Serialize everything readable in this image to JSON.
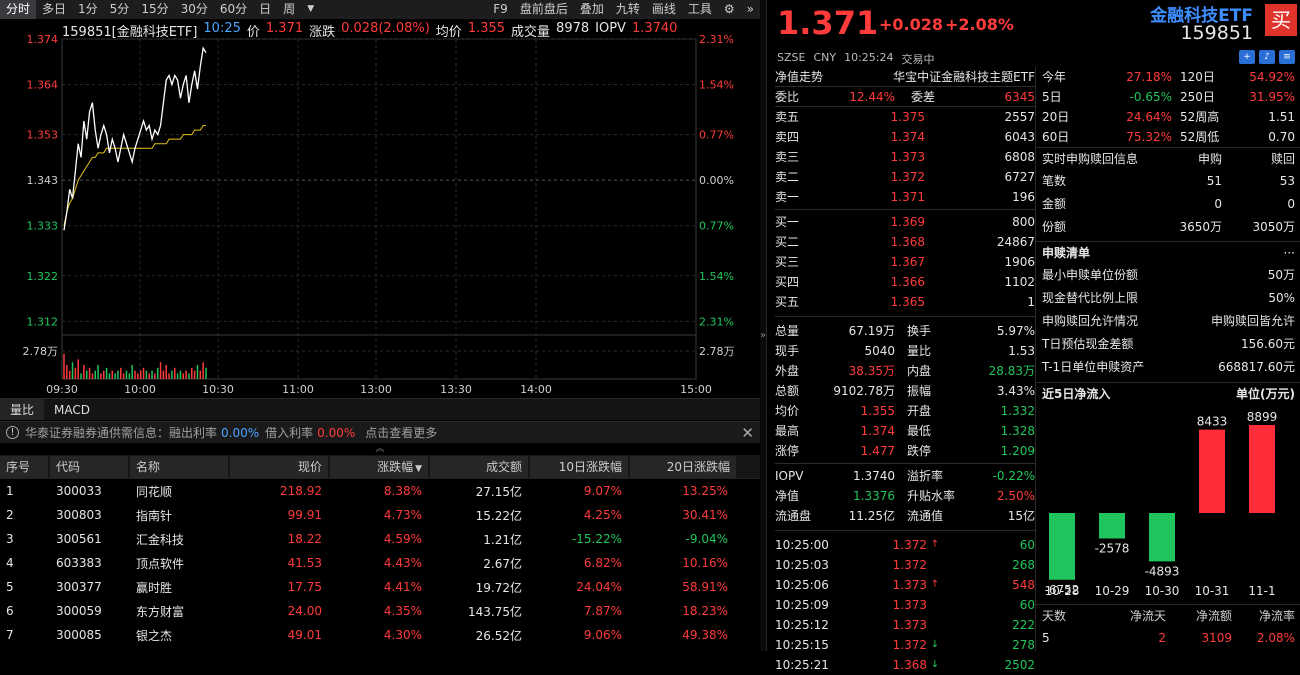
{
  "toolbar": {
    "items": [
      "分时",
      "多日",
      "1分",
      "5分",
      "15分",
      "30分",
      "60分",
      "日",
      "周"
    ],
    "tools": [
      "F9",
      "盘前盘后",
      "叠加",
      "九转",
      "画线",
      "工具"
    ]
  },
  "chart": {
    "header": {
      "code_name": "159851[金融科技ETF]",
      "time": "10:25",
      "price_label": "价",
      "price": "1.371",
      "chg_label": "涨跌",
      "chg": "0.028(2.08%)",
      "avg_label": "均价",
      "avg": "1.355",
      "vol_label": "成交量",
      "vol": "8978",
      "iopv_label": "IOPV",
      "iopv": "1.3740"
    },
    "y_left": [
      "1.374",
      "1.364",
      "1.353",
      "1.343",
      "1.333",
      "1.322",
      "1.312"
    ],
    "y_right": [
      "2.31%",
      "1.54%",
      "0.77%",
      "0.00%",
      "0.77%",
      "1.54%",
      "2.31%"
    ],
    "vol_left": "2.78万",
    "vol_right": "2.78万",
    "x_labels": [
      "09:30",
      "10:00",
      "10:30",
      "11:00",
      "13:00",
      "13:30",
      "14:00",
      "15:00"
    ],
    "prev_close": 1.343,
    "price_series": [
      1.332,
      1.336,
      1.341,
      1.339,
      1.345,
      1.351,
      1.348,
      1.356,
      1.352,
      1.358,
      1.36,
      1.354,
      1.35,
      1.353,
      1.355,
      1.353,
      1.349,
      1.352,
      1.35,
      1.347,
      1.35,
      1.353,
      1.351,
      1.349,
      1.347,
      1.35,
      1.352,
      1.354,
      1.356,
      1.354,
      1.355,
      1.352,
      1.354,
      1.353,
      1.355,
      1.36,
      1.365,
      1.366,
      1.364,
      1.366,
      1.365,
      1.361,
      1.364,
      1.366,
      1.36,
      1.364,
      1.367,
      1.363,
      1.368,
      1.372,
      1.371
    ],
    "avg_series": [
      1.333,
      1.336,
      1.338,
      1.339,
      1.341,
      1.343,
      1.344,
      1.345,
      1.346,
      1.347,
      1.348,
      1.348,
      1.349,
      1.349,
      1.349,
      1.35,
      1.35,
      1.35,
      1.35,
      1.35,
      1.35,
      1.35,
      1.35,
      1.35,
      1.35,
      1.35,
      1.35,
      1.35,
      1.35,
      1.35,
      1.35,
      1.35,
      1.351,
      1.351,
      1.351,
      1.351,
      1.351,
      1.352,
      1.352,
      1.352,
      1.352,
      1.352,
      1.353,
      1.353,
      1.353,
      1.353,
      1.354,
      1.354,
      1.354,
      1.355,
      1.355
    ],
    "vol_series": [
      0.9,
      0.5,
      0.3,
      0.6,
      0.4,
      0.7,
      0.2,
      0.5,
      0.3,
      0.4,
      0.2,
      0.3,
      0.5,
      0.2,
      0.3,
      0.4,
      0.2,
      0.3,
      0.2,
      0.3,
      0.4,
      0.2,
      0.3,
      0.2,
      0.5,
      0.3,
      0.2,
      0.3,
      0.4,
      0.3,
      0.2,
      0.3,
      0.2,
      0.4,
      0.6,
      0.3,
      0.5,
      0.2,
      0.3,
      0.4,
      0.2,
      0.3,
      0.2,
      0.3,
      0.2,
      0.4,
      0.3,
      0.5,
      0.3,
      0.6,
      0.4
    ]
  },
  "subtabs": [
    "量比",
    "MACD"
  ],
  "notice": {
    "prefix": "华泰证券融券通供需信息：融出利率",
    "rate1": "0.00%",
    "mid": "借入利率",
    "rate2": "0.00%",
    "suffix": "点击查看更多"
  },
  "table": {
    "headers": [
      "序号",
      "代码",
      "名称",
      "现价",
      "涨跌幅",
      "成交额",
      "10日涨跌幅",
      "20日涨跌幅"
    ],
    "rows": [
      [
        "1",
        "300033",
        "同花顺",
        "218.92",
        "8.38%",
        "27.15亿",
        "9.07%",
        "13.25%"
      ],
      [
        "2",
        "300803",
        "指南针",
        "99.91",
        "4.73%",
        "15.22亿",
        "4.25%",
        "30.41%"
      ],
      [
        "3",
        "300561",
        "汇金科技",
        "18.22",
        "4.59%",
        "1.21亿",
        "-15.22%",
        "-9.04%"
      ],
      [
        "4",
        "603383",
        "顶点软件",
        "41.53",
        "4.43%",
        "2.67亿",
        "6.82%",
        "10.16%"
      ],
      [
        "5",
        "300377",
        "赢时胜",
        "17.75",
        "4.41%",
        "19.72亿",
        "24.04%",
        "58.91%"
      ],
      [
        "6",
        "300059",
        "东方财富",
        "24.00",
        "4.35%",
        "143.75亿",
        "7.87%",
        "18.23%"
      ],
      [
        "7",
        "300085",
        "银之杰",
        "49.01",
        "4.30%",
        "26.52亿",
        "9.06%",
        "49.38%"
      ]
    ]
  },
  "quote": {
    "price": "1.371",
    "chg": "+0.028",
    "pct": "+2.08%",
    "name": "金融科技ETF",
    "code": "159851",
    "trade_btn": "买",
    "exch": "SZSE",
    "cur": "CNY",
    "time": "10:25:24",
    "status": "交易中",
    "nav_label": "净值走势",
    "index_name": "华宝中证金融科技主题ETF",
    "wb_label": "委比",
    "wb": "12.44%",
    "wc_label": "委差",
    "wc": "6345",
    "asks": [
      [
        "卖五",
        "1.375",
        "2557"
      ],
      [
        "卖四",
        "1.374",
        "6043"
      ],
      [
        "卖三",
        "1.373",
        "6808"
      ],
      [
        "卖二",
        "1.372",
        "6727"
      ],
      [
        "卖一",
        "1.371",
        "196"
      ]
    ],
    "bids": [
      [
        "买一",
        "1.369",
        "800"
      ],
      [
        "买二",
        "1.368",
        "24867"
      ],
      [
        "买三",
        "1.367",
        "1906"
      ],
      [
        "买四",
        "1.366",
        "1102"
      ],
      [
        "买五",
        "1.365",
        "1"
      ]
    ],
    "stats": [
      [
        "总量",
        "67.19万",
        "换手",
        "5.97%"
      ],
      [
        "现手",
        "5040",
        "量比",
        "1.53"
      ],
      [
        "外盘",
        "38.35万",
        "内盘",
        "28.83万"
      ],
      [
        "总额",
        "9102.78万",
        "振幅",
        "3.43%"
      ],
      [
        "均价",
        "1.355",
        "开盘",
        "1.332"
      ],
      [
        "最高",
        "1.374",
        "最低",
        "1.328"
      ],
      [
        "涨停",
        "1.477",
        "跌停",
        "1.209"
      ]
    ],
    "stats2": [
      [
        "IOPV",
        "1.3740",
        "溢折率",
        "-0.22%"
      ],
      [
        "净值",
        "1.3376",
        "升贴水率",
        "2.50%"
      ],
      [
        "流通盘",
        "11.25亿",
        "流通值",
        "15亿"
      ]
    ],
    "ticks": [
      [
        "10:25:00",
        "1.372",
        "60",
        "up"
      ],
      [
        "10:25:03",
        "1.372",
        "268",
        ""
      ],
      [
        "10:25:06",
        "1.373",
        "548",
        "up"
      ],
      [
        "10:25:09",
        "1.373",
        "60",
        ""
      ],
      [
        "10:25:12",
        "1.373",
        "222",
        ""
      ],
      [
        "10:25:15",
        "1.372",
        "278",
        "down"
      ],
      [
        "10:25:21",
        "1.368",
        "2502",
        "down"
      ]
    ]
  },
  "perf": [
    [
      "今年",
      "27.18%",
      "120日",
      "54.92%"
    ],
    [
      "5日",
      "-0.65%",
      "250日",
      "31.95%"
    ],
    [
      "20日",
      "24.64%",
      "52周高",
      "1.51"
    ],
    [
      "60日",
      "75.32%",
      "52周低",
      "0.70"
    ]
  ],
  "sg": {
    "title": "实时申购赎回信息",
    "col1": "申购",
    "col2": "赎回",
    "rows": [
      [
        "笔数",
        "51",
        "53"
      ],
      [
        "金额",
        "0",
        "0"
      ],
      [
        "份额",
        "3650万",
        "3050万"
      ]
    ]
  },
  "list": {
    "title": "申赎清单",
    "more": "···",
    "rows": [
      [
        "最小申赎单位份额",
        "50万"
      ],
      [
        "现金替代比例上限",
        "50%"
      ],
      [
        "申购赎回允许情况",
        "申购赎回皆允许"
      ],
      [
        "T日预估现金差额",
        "156.60元"
      ],
      [
        "T-1日单位申赎资产",
        "668817.60元"
      ]
    ]
  },
  "flow": {
    "title": "近5日净流入",
    "unit": "单位(万元)",
    "days": [
      "10-28",
      "10-29",
      "10-30",
      "10-31",
      "11-1"
    ],
    "values": [
      -6752,
      -2578,
      -4893,
      8433,
      8899
    ],
    "labels": [
      "-6752",
      "-2578",
      "-4893",
      "8433",
      "8899"
    ],
    "footer_headers": [
      "天数",
      "净流天",
      "净流额",
      "净流率"
    ],
    "footer_values": [
      "5",
      "2",
      "3109",
      "2.08%"
    ]
  }
}
